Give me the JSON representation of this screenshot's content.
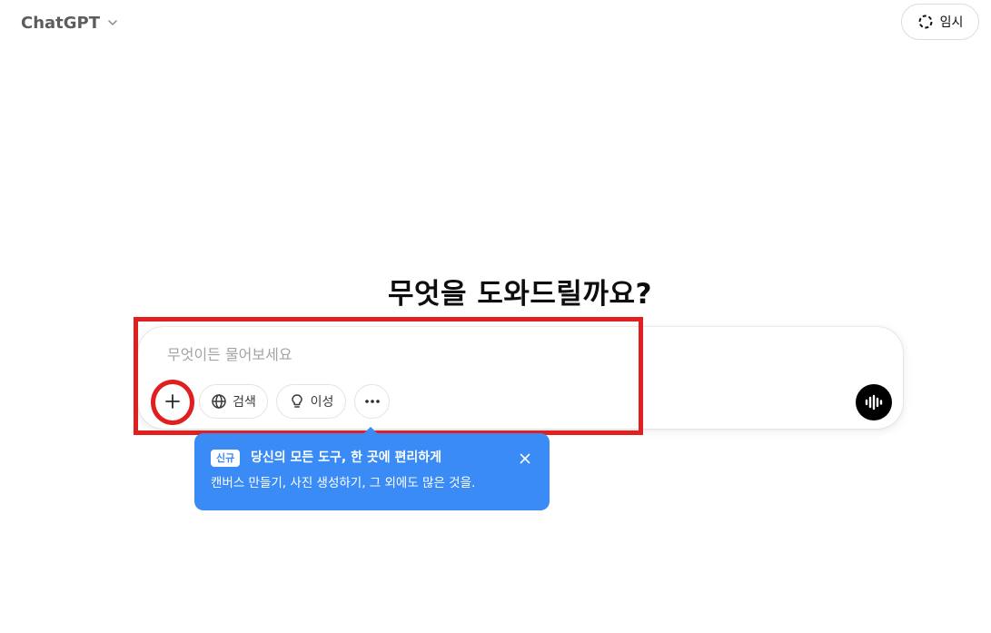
{
  "header": {
    "model_name": "ChatGPT",
    "temporary_chat_label": "임시"
  },
  "main": {
    "headline": "무엇을 도와드릴까요?"
  },
  "composer": {
    "placeholder": "무엇이든 물어보세요",
    "value": "",
    "tools": {
      "search_label": "검색",
      "reason_label": "이성"
    }
  },
  "tooltip": {
    "badge": "신규",
    "title": "당신의 모든 도구, 한 곳에 편리하게",
    "description": "캔버스 만들기, 사진 생성하기, 그 외에도 많은 것을."
  },
  "colors": {
    "tooltip_bg": "#3a8bf5",
    "annotation_red": "#e02020",
    "voice_button_bg": "#000000"
  },
  "icons": {
    "model_chevron": "chevron-down-icon",
    "temporary": "dashed-circle-icon",
    "add": "plus-icon",
    "search": "globe-icon",
    "reason": "lightbulb-icon",
    "more": "ellipsis-icon",
    "voice": "voice-waveform-icon",
    "close": "close-icon"
  }
}
